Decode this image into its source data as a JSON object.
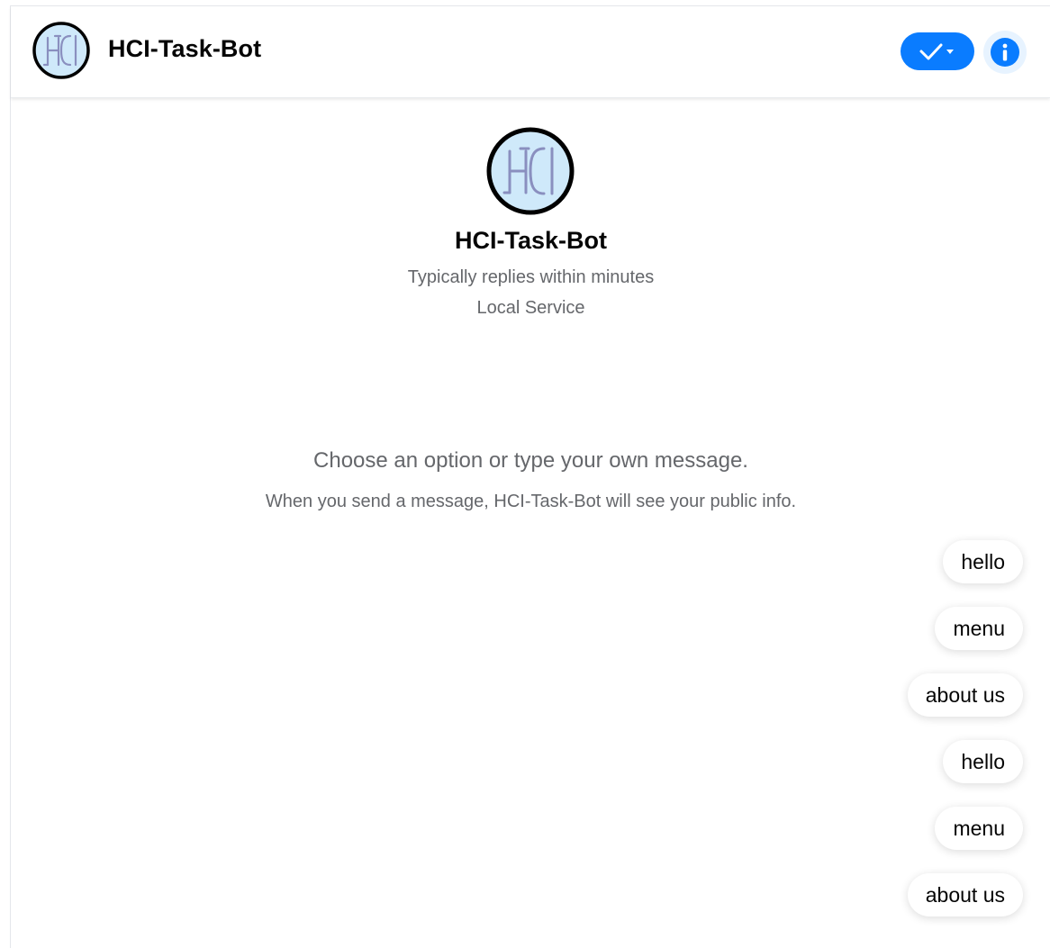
{
  "header": {
    "title": "HCI-Task-Bot",
    "avatar_icon": "hci-logo-icon",
    "status_icon": "checkmark-dropdown-icon",
    "info_icon": "info-icon"
  },
  "profile": {
    "name": "HCI-Task-Bot",
    "response_time": "Typically replies within minutes",
    "category": "Local Service"
  },
  "prompt": {
    "title": "Choose an option or type your own message.",
    "note": "When you send a message, HCI-Task-Bot will see your public info."
  },
  "quick_replies": [
    {
      "label": "hello"
    },
    {
      "label": "menu"
    },
    {
      "label": "about us"
    },
    {
      "label": "hello"
    },
    {
      "label": "menu"
    },
    {
      "label": "about us"
    }
  ],
  "colors": {
    "accent": "#0a7cff",
    "info_bg": "#e7f3ff",
    "secondary_text": "#65676b",
    "avatar_bg": "#cfe9fa"
  }
}
